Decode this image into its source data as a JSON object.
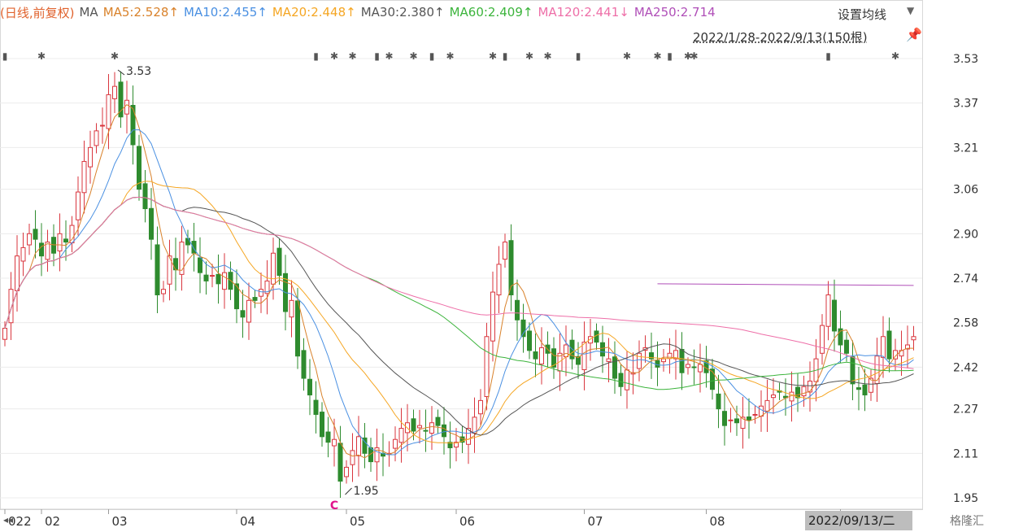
{
  "legend": [
    {
      "text": "(日线,前复权)",
      "color": "#e0622d"
    },
    {
      "text": "MA",
      "color": "#555555"
    },
    {
      "text": "MA5:2.528↑",
      "color": "#d9822b"
    },
    {
      "text": "MA10:2.455↑",
      "color": "#4a90e2"
    },
    {
      "text": "MA20:2.448↑",
      "color": "#f5a623"
    },
    {
      "text": "MA30:2.380↑",
      "color": "#555555"
    },
    {
      "text": "MA60:2.409↑",
      "color": "#3cb43c"
    },
    {
      "text": "MA120:2.441↓",
      "color": "#ee6fa8"
    },
    {
      "text": "MA250:2.714",
      "color": "#b04fb8"
    }
  ],
  "settings_label": "设置均线",
  "range_label": "2022/1/28-2022/9/13(150根)",
  "footer_date": "2022/09/13/二",
  "watermark": "格隆汇",
  "nav_icon": "double-left-arrow-icon",
  "chart_data": {
    "type": "candlestick",
    "y_ticks": [
      "3.53",
      "3.37",
      "3.21",
      "3.06",
      "2.90",
      "2.74",
      "2.58",
      "2.42",
      "2.27",
      "2.11",
      "1.95"
    ],
    "ylim": [
      1.95,
      3.53
    ],
    "x_labels": [
      {
        "label": "022",
        "index": 0
      },
      {
        "label": "02",
        "index": 6
      },
      {
        "label": "03",
        "index": 17
      },
      {
        "label": "04",
        "index": 38
      },
      {
        "label": "05",
        "index": 56
      },
      {
        "label": "06",
        "index": 74
      },
      {
        "label": "07",
        "index": 95
      },
      {
        "label": "08",
        "index": 115
      },
      {
        "label": "09",
        "index": 137
      }
    ],
    "high_annotation": "3.53",
    "low_annotation": "1.95",
    "marker_label": "C",
    "colors": {
      "up": "#d9363e",
      "down": "#2e8b2e",
      "ma5": "#d9822b",
      "ma10": "#4a90e2",
      "ma20": "#f5a623",
      "ma30": "#555555",
      "ma60": "#3cb43c",
      "ma120": "#ee6fa8",
      "ma250": "#b04fb8"
    },
    "closes": [
      2.56,
      2.7,
      2.82,
      2.85,
      2.9,
      2.88,
      2.82,
      2.87,
      2.83,
      2.9,
      2.87,
      2.93,
      3.05,
      3.16,
      3.21,
      3.27,
      3.29,
      3.4,
      3.43,
      3.32,
      3.38,
      3.22,
      3.06,
      2.99,
      2.88,
      2.68,
      2.7,
      2.82,
      2.77,
      2.87,
      2.86,
      2.83,
      2.76,
      2.73,
      2.75,
      2.72,
      2.76,
      2.7,
      2.63,
      2.6,
      2.66,
      2.66,
      2.7,
      2.73,
      2.83,
      2.75,
      2.62,
      2.66,
      2.46,
      2.38,
      2.32,
      2.25,
      2.17,
      2.15,
      2.16,
      2.01,
      2.06,
      2.12,
      2.17,
      2.11,
      2.08,
      2.13,
      2.1,
      2.11,
      2.16,
      2.2,
      2.22,
      2.19,
      2.21,
      2.19,
      2.22,
      2.21,
      2.17,
      2.13,
      2.15,
      2.15,
      2.2,
      2.24,
      2.3,
      2.53,
      2.69,
      2.79,
      2.87,
      2.68,
      2.59,
      2.53,
      2.48,
      2.45,
      2.49,
      2.47,
      2.42,
      2.47,
      2.5,
      2.45,
      2.43,
      2.51,
      2.53,
      2.51,
      2.46,
      2.45,
      2.38,
      2.35,
      2.41,
      2.4,
      2.47,
      2.49,
      2.45,
      2.42,
      2.45,
      2.47,
      2.48,
      2.4,
      2.43,
      2.42,
      2.43,
      2.4,
      2.34,
      2.27,
      2.21,
      2.23,
      2.22,
      2.24,
      2.23,
      2.25,
      2.28,
      2.3,
      2.32,
      2.33,
      2.31,
      2.33,
      2.31,
      2.35,
      2.37,
      2.45,
      2.57,
      2.68,
      2.55,
      2.5,
      2.47,
      2.36,
      2.34,
      2.32,
      2.38,
      2.46,
      2.53,
      2.45,
      2.48,
      2.48,
      2.5,
      2.53
    ]
  }
}
